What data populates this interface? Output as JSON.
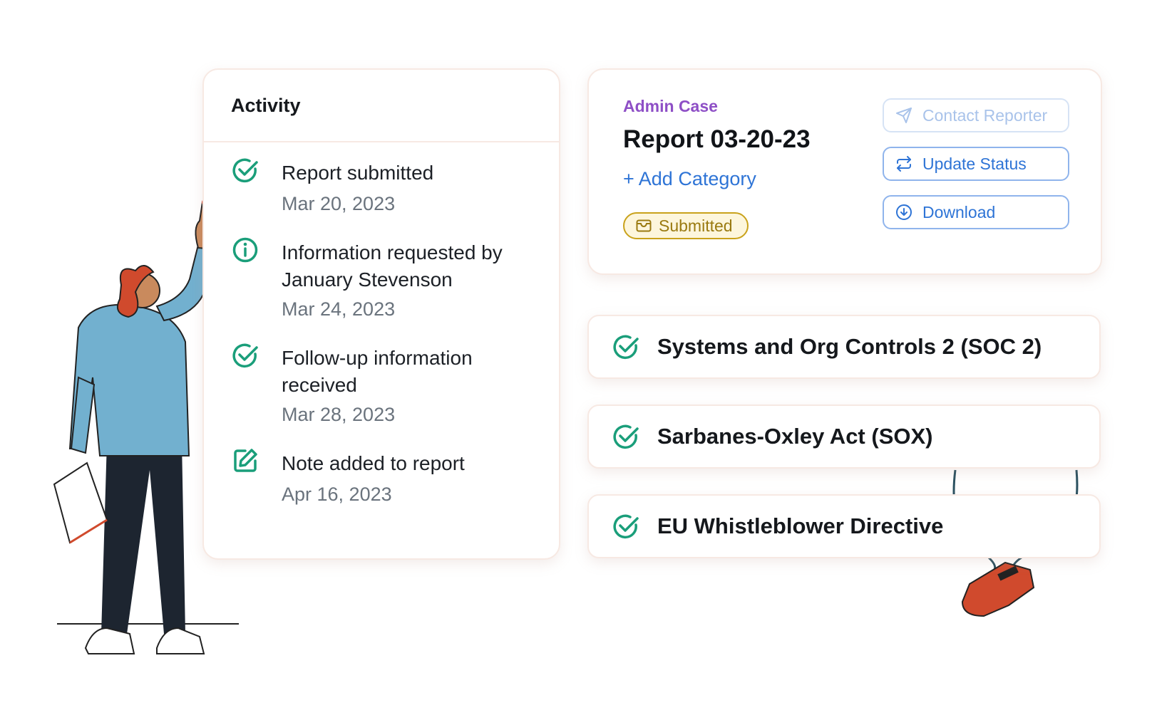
{
  "activity": {
    "title": "Activity",
    "items": [
      {
        "icon": "check-circle-icon",
        "title": "Report submitted",
        "date": "Mar 20, 2023"
      },
      {
        "icon": "info-circle-icon",
        "title": "Information requested by January Stevenson",
        "date": "Mar 24, 2023"
      },
      {
        "icon": "check-circle-icon",
        "title": "Follow-up information received",
        "date": "Mar 28, 2023"
      },
      {
        "icon": "edit-note-icon",
        "title": "Note added to report",
        "date": "Apr 16, 2023"
      }
    ]
  },
  "report": {
    "case_type": "Admin Case",
    "title": "Report 03-20-23",
    "add_category": "+ Add Category",
    "status": "Submitted",
    "actions": {
      "contact": "Contact Reporter",
      "update": "Update Status",
      "download": "Download"
    }
  },
  "compliance": [
    {
      "label": "Systems and Org Controls 2 (SOC 2)"
    },
    {
      "label": "Sarbanes-Oxley Act (SOX)"
    },
    {
      "label": "EU Whistleblower Directive"
    }
  ],
  "colors": {
    "accent_green": "#1a9e7a",
    "link_blue": "#2e74d6",
    "admin_purple": "#8e4fc6",
    "status_gold": "#c9a21b"
  }
}
